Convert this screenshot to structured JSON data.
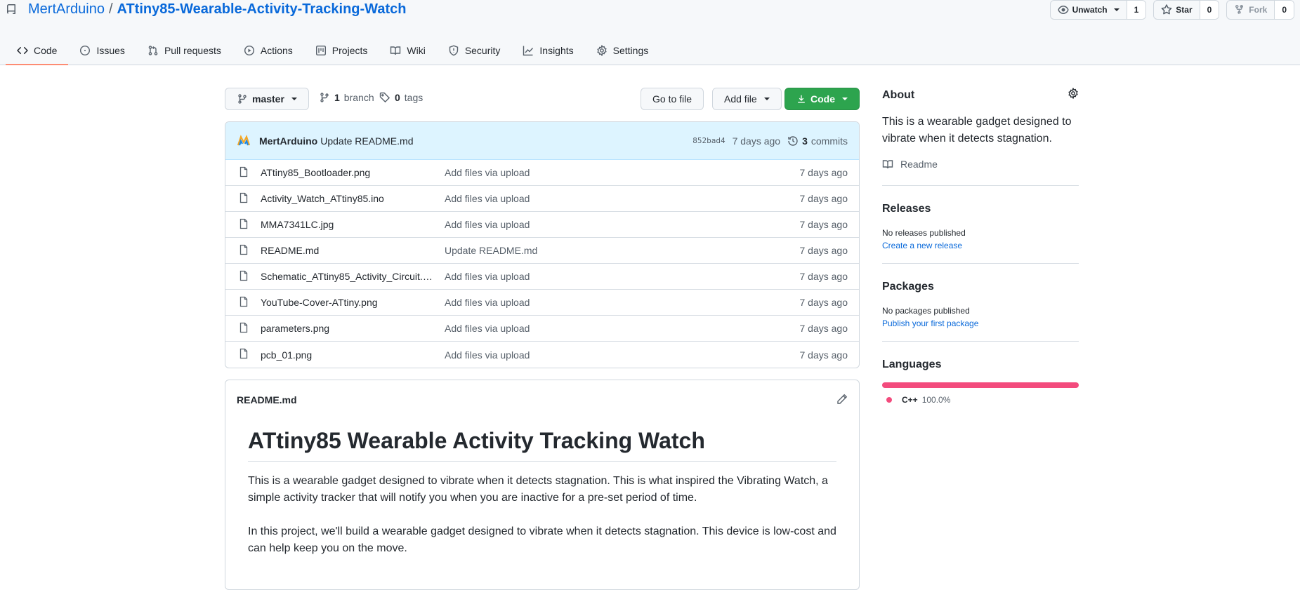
{
  "repo": {
    "owner": "MertArduino",
    "separator": "/",
    "name": "ATtiny85-Wearable-Activity-Tracking-Watch"
  },
  "actions": {
    "watch_label": "Unwatch",
    "watch_count": "1",
    "star_label": "Star",
    "star_count": "0",
    "fork_label": "Fork",
    "fork_count": "0"
  },
  "tabs": [
    {
      "label": "Code",
      "icon": "code-icon"
    },
    {
      "label": "Issues",
      "icon": "issue-icon"
    },
    {
      "label": "Pull requests",
      "icon": "pull-request-icon"
    },
    {
      "label": "Actions",
      "icon": "play-icon"
    },
    {
      "label": "Projects",
      "icon": "project-icon"
    },
    {
      "label": "Wiki",
      "icon": "book-icon"
    },
    {
      "label": "Security",
      "icon": "shield-icon"
    },
    {
      "label": "Insights",
      "icon": "graph-icon"
    },
    {
      "label": "Settings",
      "icon": "gear-icon"
    }
  ],
  "toolbar": {
    "branch": "master",
    "branch_count": "1",
    "branch_label": "branch",
    "tag_count": "0",
    "tag_label": "tags",
    "go_to_file": "Go to file",
    "add_file": "Add file",
    "code": "Code"
  },
  "commit": {
    "author": "MertArduino",
    "message": "Update README.md",
    "sha": "852bad4",
    "age": "7 days ago",
    "count": "3",
    "count_label": "commits"
  },
  "files": [
    {
      "name": "ATtiny85_Bootloader.png",
      "message": "Add files via upload",
      "age": "7 days ago"
    },
    {
      "name": "Activity_Watch_ATtiny85.ino",
      "message": "Add files via upload",
      "age": "7 days ago"
    },
    {
      "name": "MMA7341LC.jpg",
      "message": "Add files via upload",
      "age": "7 days ago"
    },
    {
      "name": "README.md",
      "message": "Update README.md",
      "age": "7 days ago"
    },
    {
      "name": "Schematic_ATtiny85_Activity_Circuit.p...",
      "message": "Add files via upload",
      "age": "7 days ago"
    },
    {
      "name": "YouTube-Cover-ATtiny.png",
      "message": "Add files via upload",
      "age": "7 days ago"
    },
    {
      "name": "parameters.png",
      "message": "Add files via upload",
      "age": "7 days ago"
    },
    {
      "name": "pcb_01.png",
      "message": "Add files via upload",
      "age": "7 days ago"
    }
  ],
  "readme": {
    "filename": "README.md",
    "heading": "ATtiny85 Wearable Activity Tracking Watch",
    "p1": "This is a wearable gadget designed to vibrate when it detects stagnation. This is what inspired the Vibrating Watch, a simple activity tracker that will notify you when you are inactive for a pre-set period of time.",
    "p2": "In this project, we'll build a wearable gadget designed to vibrate when it detects stagnation. This device is low-cost and can help keep you on the move."
  },
  "sidebar": {
    "about_title": "About",
    "about_text": "This is a wearable gadget designed to vibrate when it detects stagnation.",
    "readme_link": "Readme",
    "releases_title": "Releases",
    "releases_text": "No releases published",
    "releases_link": "Create a new release",
    "packages_title": "Packages",
    "packages_text": "No packages published",
    "packages_link": "Publish your first package",
    "languages_title": "Languages",
    "language_name": "C++",
    "language_pct": "100.0%"
  },
  "colors": {
    "accent": "#0969da",
    "primary_button": "#2da44e",
    "cpp_language": "#f34b7d",
    "tab_underline": "#fd8c73"
  }
}
